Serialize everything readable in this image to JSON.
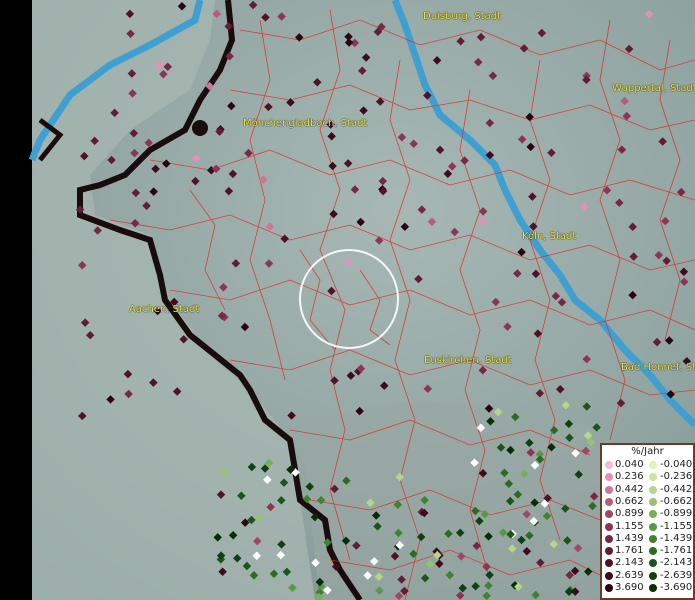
{
  "map": {
    "cities": [
      {
        "name": "Duisburg, Stadt"
      },
      {
        "name": "Mönchengladbach, Stadt"
      },
      {
        "name": "Wuppertal, Stadt"
      },
      {
        "name": "Köln, Stadt"
      },
      {
        "name": "Aachen, Stadt"
      },
      {
        "name": "Euskirchen, Stadt"
      },
      {
        "name": "Bad Honnef, Stadt"
      }
    ],
    "colors": {
      "water": "#3f9fd0",
      "border": "#e02a2a",
      "frontier": "#1a0c0c",
      "highlight_ring": "#ffffff"
    }
  },
  "legend": {
    "title": "%/Jahr",
    "rows": [
      {
        "pos": "0.040",
        "neg": "-0.040",
        "pos_color": "#f4b8dc",
        "neg_color": "#e6f0b8"
      },
      {
        "pos": "0.236",
        "neg": "-0.236",
        "pos_color": "#e590b8",
        "neg_color": "#cfe3a0"
      },
      {
        "pos": "0.442",
        "neg": "-0.442",
        "pos_color": "#d27496",
        "neg_color": "#b6d48a"
      },
      {
        "pos": "0.662",
        "neg": "-0.662",
        "pos_color": "#b85a7a",
        "neg_color": "#98c270"
      },
      {
        "pos": "0.899",
        "neg": "-0.899",
        "pos_color": "#a04766",
        "neg_color": "#78ae58"
      },
      {
        "pos": "1.155",
        "neg": "-1.155",
        "pos_color": "#8a3654",
        "neg_color": "#5a9844"
      },
      {
        "pos": "1.439",
        "neg": "-1.439",
        "pos_color": "#762844",
        "neg_color": "#3e8232"
      },
      {
        "pos": "1.761",
        "neg": "-1.761",
        "pos_color": "#621c36",
        "neg_color": "#2a6c24"
      },
      {
        "pos": "2.143",
        "neg": "-2.143",
        "pos_color": "#501228",
        "neg_color": "#1a561a"
      },
      {
        "pos": "2.639",
        "neg": "-2.639",
        "pos_color": "#3e0a1c",
        "neg_color": "#0e4012"
      },
      {
        "pos": "3.690",
        "neg": "-3.690",
        "pos_color": "#2a0410",
        "neg_color": "#062c0a"
      }
    ]
  }
}
